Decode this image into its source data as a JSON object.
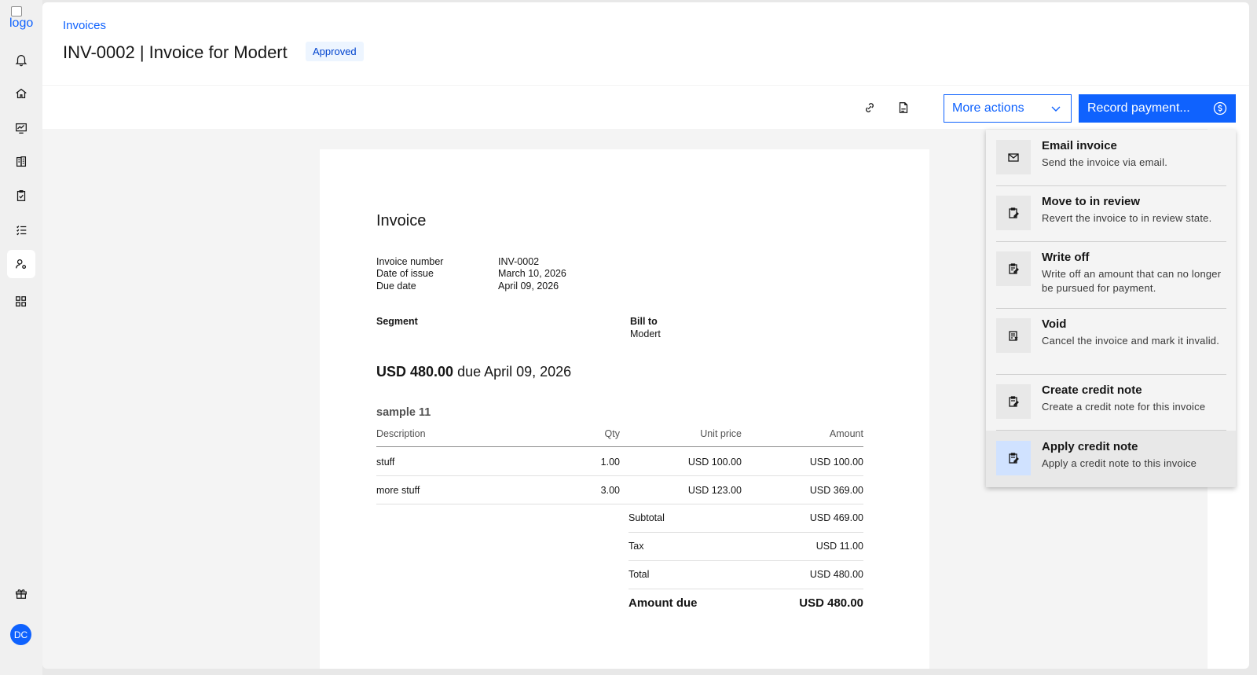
{
  "app": {
    "logo_alt": "logo",
    "user_initials": "DC"
  },
  "rail": {
    "items": [
      {
        "icon": "bell-icon"
      },
      {
        "icon": "home-icon"
      },
      {
        "icon": "dashboard-icon"
      },
      {
        "icon": "building-icon"
      },
      {
        "icon": "clipboard-check-icon"
      },
      {
        "icon": "task-list-icon"
      },
      {
        "icon": "user-settings-icon",
        "active": true
      },
      {
        "icon": "apps-icon"
      },
      {
        "icon": "gift-icon"
      }
    ]
  },
  "header": {
    "breadcrumb": "Invoices",
    "title": "INV-0002 | Invoice for Modert",
    "status": "Approved"
  },
  "toolbar": {
    "link_icon": "link-icon",
    "pdf_icon": "pdf-icon",
    "more_actions_label": "More actions",
    "record_payment_label": "Record payment..."
  },
  "menu": {
    "items": [
      {
        "title": "Email invoice",
        "desc": "Send the invoice via email.",
        "icon": "email-icon"
      },
      {
        "title": "Move to in review",
        "desc": "Revert the invoice to in review state.",
        "icon": "document-review-icon"
      },
      {
        "title": "Write off",
        "desc": "Write off an amount that can no longer be pursued for payment.",
        "icon": "document-edit-icon"
      },
      {
        "title": "Void",
        "desc": "Cancel the invoice and mark it invalid.",
        "icon": "document-void-icon"
      },
      {
        "title": "Create credit note",
        "desc": "Create a credit note for this invoice",
        "icon": "document-credit-icon"
      },
      {
        "title": "Apply credit note",
        "desc": "Apply a credit note to this invoice",
        "icon": "document-apply-icon",
        "highlighted": true
      }
    ]
  },
  "invoice": {
    "heading": "Invoice",
    "meta": [
      {
        "label": "Invoice number",
        "value": "INV-0002"
      },
      {
        "label": "Date of issue",
        "value": "March 10, 2026"
      },
      {
        "label": "Due date",
        "value": "April 09, 2026"
      }
    ],
    "segment_label": "Segment",
    "bill_to_label": "Bill to",
    "bill_to_name": "Modert",
    "due_amount": "USD 480.00",
    "due_text": " due April 09, 2026",
    "group_title": "sample 11",
    "columns": [
      "Description",
      "Qty",
      "Unit price",
      "Amount"
    ],
    "lines": [
      {
        "description": "stuff",
        "qty": "1.00",
        "unit_price": "USD 100.00",
        "amount": "USD 100.00"
      },
      {
        "description": "more stuff",
        "qty": "3.00",
        "unit_price": "USD 123.00",
        "amount": "USD 369.00"
      }
    ],
    "totals": [
      {
        "label": "Subtotal",
        "value": "USD 469.00"
      },
      {
        "label": "Tax",
        "value": "USD 11.00"
      },
      {
        "label": "Total",
        "value": "USD 480.00"
      }
    ],
    "amount_due_label": "Amount due",
    "amount_due_value": "USD 480.00"
  },
  "side_rail": {
    "items": [
      {
        "icon": "chat-icon"
      },
      {
        "icon": "clipboard-check-icon"
      },
      {
        "icon": "user-avatar-icon"
      },
      {
        "icon": "receipt-dollar-icon"
      }
    ]
  }
}
